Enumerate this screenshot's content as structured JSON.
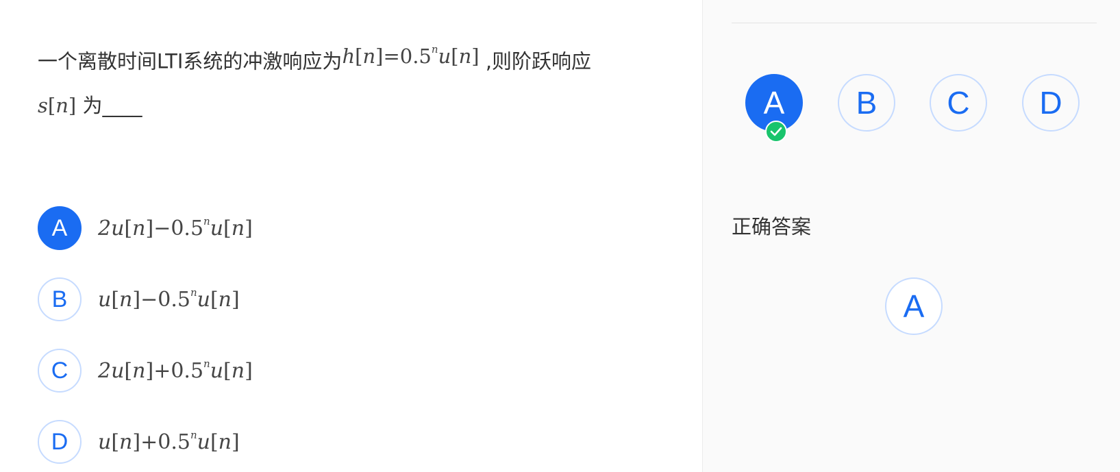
{
  "question": {
    "text_before": "一个离散时间LTI系统的冲激响应为",
    "formula_h": {
      "lhs": "h",
      "index": "n",
      "eq": "=0.5",
      "exp": "n",
      "rhs": "u",
      "rhs_index": "n"
    },
    "text_middle": ",则阶跃响应",
    "formula_s": {
      "symbol": "s",
      "index": "n"
    },
    "text_after": "为____"
  },
  "options": [
    {
      "letter": "A",
      "formula": {
        "pre": "2u",
        "idx1": "n",
        "op": "−0.5",
        "exp": "n",
        "post": "u",
        "idx2": "n"
      },
      "selected": true
    },
    {
      "letter": "B",
      "formula": {
        "pre": "u",
        "idx1": "n",
        "op": "−0.5",
        "exp": "n",
        "post": "u",
        "idx2": "n"
      },
      "selected": false
    },
    {
      "letter": "C",
      "formula": {
        "pre": "2u",
        "idx1": "n",
        "op": "+0.5",
        "exp": "n",
        "post": "u",
        "idx2": "n"
      },
      "selected": false
    },
    {
      "letter": "D",
      "formula": {
        "pre": "u",
        "idx1": "n",
        "op": "+0.5",
        "exp": "n",
        "post": "u",
        "idx2": "n"
      },
      "selected": false
    }
  ],
  "side": {
    "nav": [
      "A",
      "B",
      "C",
      "D"
    ],
    "correct_label": "正确答案",
    "correct_answer": "A"
  },
  "colors": {
    "accent": "#1a6cf2",
    "correct": "#19c46c",
    "circle_border": "#c6dbff",
    "side_bg": "#fafafa"
  },
  "icons": {
    "check": "check-icon"
  }
}
